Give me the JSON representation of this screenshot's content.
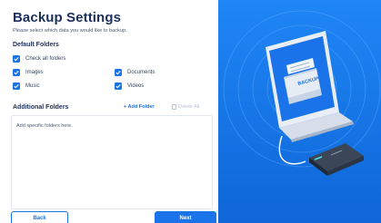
{
  "header": {
    "title": "Backup Settings",
    "subtitle": "Please select which data you would like to backup."
  },
  "default_folders": {
    "label": "Default Folders",
    "check_all": {
      "label": "Check all folders",
      "checked": true
    },
    "items": [
      {
        "label": "Images",
        "checked": true
      },
      {
        "label": "Documents",
        "checked": true
      },
      {
        "label": "Music",
        "checked": true
      },
      {
        "label": "Videos",
        "checked": true
      }
    ]
  },
  "additional_folders": {
    "label": "Additional Folders",
    "add_label": "+ Add Folder",
    "delete_label": "Delete All",
    "placeholder": "Add specific folders here."
  },
  "buttons": {
    "back_label": "Back",
    "next_label": "Next"
  },
  "illustration": {
    "screen_label": "BACKUP"
  },
  "colors": {
    "accent": "#1a73e8",
    "panel_bg": "#1a7bf0",
    "title": "#1b2f5c"
  }
}
